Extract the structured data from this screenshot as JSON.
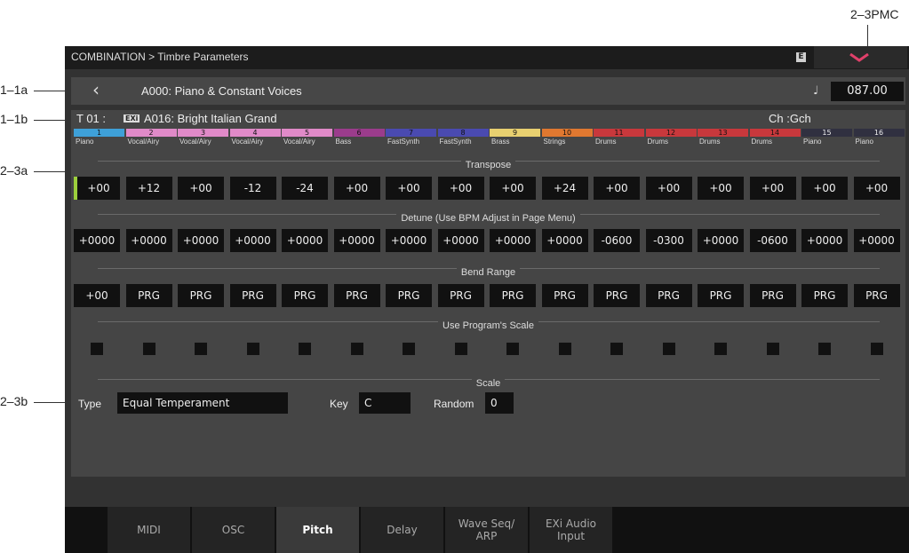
{
  "callouts": {
    "pmc": "2–3PMC",
    "c1a": "1–1a",
    "c1b": "1–1b",
    "c3a": "2–3a",
    "c3b": "2–3b"
  },
  "topbar": {
    "title": "COMBINATION > Timbre Parameters",
    "e_badge": "E",
    "pmc_icon": "chevron-down-icon"
  },
  "combi": {
    "back_icon": "chevron-left-icon",
    "name": "A000: Piano & Constant Voices",
    "note_icon": "♩",
    "tempo": "087.00"
  },
  "timbre_header": {
    "prefix": "T 01 :",
    "exi_badge": "EXi",
    "program": "A016: Bright Italian Grand",
    "ch": "Ch :Gch"
  },
  "timbres": [
    {
      "num": "1",
      "cat": "Piano",
      "color": "#3ea0d8"
    },
    {
      "num": "2",
      "cat": "Vocal/Airy",
      "color": "#e08ac8"
    },
    {
      "num": "3",
      "cat": "Vocal/Airy",
      "color": "#e08ac8"
    },
    {
      "num": "4",
      "cat": "Vocal/Airy",
      "color": "#e08ac8"
    },
    {
      "num": "5",
      "cat": "Vocal/Airy",
      "color": "#e08ac8"
    },
    {
      "num": "6",
      "cat": "Bass",
      "color": "#9b3c8c"
    },
    {
      "num": "7",
      "cat": "FastSynth",
      "color": "#4a4ab0"
    },
    {
      "num": "8",
      "cat": "FastSynth",
      "color": "#4a4ab0"
    },
    {
      "num": "9",
      "cat": "Brass",
      "color": "#e8d070"
    },
    {
      "num": "10",
      "cat": "Strings",
      "color": "#e07830"
    },
    {
      "num": "11",
      "cat": "Drums",
      "color": "#c8383c"
    },
    {
      "num": "12",
      "cat": "Drums",
      "color": "#c8383c"
    },
    {
      "num": "13",
      "cat": "Drums",
      "color": "#c8383c"
    },
    {
      "num": "14",
      "cat": "Drums",
      "color": "#c8383c"
    },
    {
      "num": "15",
      "cat": "Piano",
      "color": "#303040"
    },
    {
      "num": "16",
      "cat": "Piano",
      "color": "#303040"
    }
  ],
  "transpose": {
    "title": "Transpose",
    "values": [
      "+00",
      "+12",
      "+00",
      "-12",
      "-24",
      "+00",
      "+00",
      "+00",
      "+00",
      "+24",
      "+00",
      "+00",
      "+00",
      "+00",
      "+00",
      "+00"
    ]
  },
  "detune": {
    "title": "Detune (Use BPM Adjust in Page Menu)",
    "values": [
      "+0000",
      "+0000",
      "+0000",
      "+0000",
      "+0000",
      "+0000",
      "+0000",
      "+0000",
      "+0000",
      "+0000",
      "-0600",
      "-0300",
      "+0000",
      "-0600",
      "+0000",
      "+0000"
    ]
  },
  "bend": {
    "title": "Bend Range",
    "values": [
      "+00",
      "PRG",
      "PRG",
      "PRG",
      "PRG",
      "PRG",
      "PRG",
      "PRG",
      "PRG",
      "PRG",
      "PRG",
      "PRG",
      "PRG",
      "PRG",
      "PRG",
      "PRG"
    ]
  },
  "use_scale": {
    "title": "Use Program's Scale",
    "checked": [
      false,
      false,
      false,
      false,
      false,
      false,
      false,
      false,
      false,
      false,
      false,
      false,
      false,
      false,
      false,
      false
    ]
  },
  "scale": {
    "title": "Scale",
    "type_label": "Type",
    "type_value": "Equal Temperament",
    "key_label": "Key",
    "key_value": "C",
    "random_label": "Random",
    "random_value": "0"
  },
  "tabs": [
    {
      "label": "MIDI",
      "active": false
    },
    {
      "label": "OSC",
      "active": false
    },
    {
      "label": "Pitch",
      "active": true
    },
    {
      "label": "Delay",
      "active": false
    },
    {
      "label": "Wave Seq/\nARP",
      "active": false
    },
    {
      "label": "EXi Audio\nInput",
      "active": false
    }
  ]
}
